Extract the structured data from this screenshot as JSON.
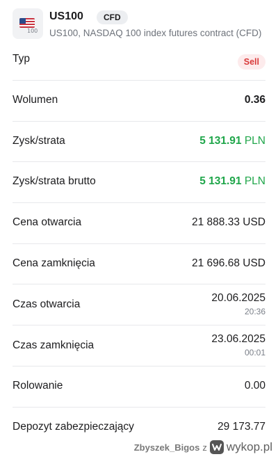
{
  "header": {
    "flag_icon": "us-flag-icon",
    "flag_number": "100",
    "symbol": "US100",
    "badge": "CFD",
    "subtitle": "US100, NASDAQ 100 index futures contract (CFD)"
  },
  "rows": {
    "typ": {
      "label": "Typ",
      "value": "Sell"
    },
    "wolumen": {
      "label": "Wolumen",
      "value": "0.36"
    },
    "zysk": {
      "label": "Zysk/strata",
      "amount": "5 131.91",
      "currency": "PLN"
    },
    "zysk_brutto": {
      "label": "Zysk/strata brutto",
      "amount": "5 131.91",
      "currency": "PLN"
    },
    "cena_otwarcia": {
      "label": "Cena otwarcia",
      "value": "21 888.33 USD"
    },
    "cena_zamkniecia": {
      "label": "Cena zamknięcia",
      "value": "21 696.68 USD"
    },
    "czas_otwarcia": {
      "label": "Czas otwarcia",
      "date": "20.06.2025",
      "time": "20:36"
    },
    "czas_zamkniecia": {
      "label": "Czas zamknięcia",
      "date": "23.06.2025",
      "time": "00:01"
    },
    "rolowanie": {
      "label": "Rolowanie",
      "value": "0.00"
    },
    "depozyt": {
      "label": "Depozyt zabezpieczający",
      "value": "29 173.77"
    }
  },
  "watermark": {
    "user": "Zbyszek_Bigos",
    "connector": "z",
    "logo_icon": "wykop-logo-icon",
    "site": "wykop.pl"
  },
  "colors": {
    "positive": "#1fa64a",
    "sell": "#d93a3a",
    "sell_bg": "#fdebec",
    "divider": "#e7e8eb"
  }
}
